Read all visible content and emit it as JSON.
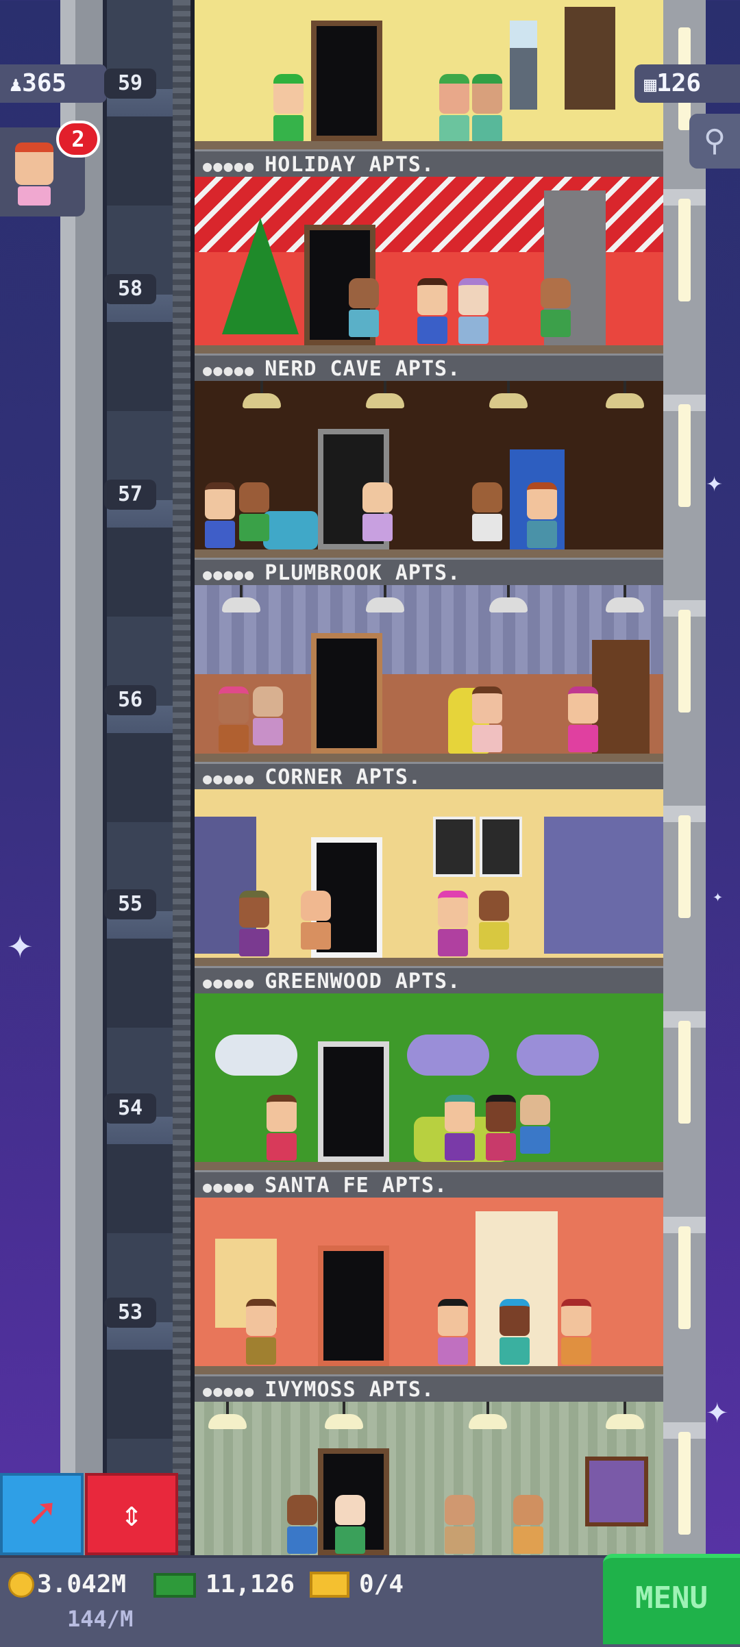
{
  "top": {
    "population": "365",
    "floors_count": "126",
    "notification_count": "2"
  },
  "floors": [
    {
      "number": "59",
      "name": "HOLIDAY APTS."
    },
    {
      "number": "58",
      "name": "NERD CAVE APTS."
    },
    {
      "number": "57",
      "name": "PLUMBROOK APTS."
    },
    {
      "number": "56",
      "name": "CORNER APTS."
    },
    {
      "number": "55",
      "name": "GREENWOOD APTS."
    },
    {
      "number": "54",
      "name": "SANTA FE APTS."
    },
    {
      "number": "53",
      "name": "IVYMOSS APTS."
    }
  ],
  "status": {
    "coins": "3.042M",
    "coins_rate": "144/M",
    "bux": "11,126",
    "tickets": "0/4"
  },
  "menu_label": "MENU",
  "colors": {
    "sky": "#33307a",
    "menu_green": "#1fb24a",
    "elevator_red": "#e8283c",
    "arrow_blue": "#2f9fe6",
    "badge_red": "#e21f2b"
  },
  "icons": {
    "population": "person-icon",
    "floors": "building-icon",
    "search": "magnifier-icon",
    "arrow": "arrow-icon",
    "elevator": "up-down-icon",
    "coin": "coin-icon",
    "bux": "bux-icon",
    "ticket": "ticket-icon"
  }
}
